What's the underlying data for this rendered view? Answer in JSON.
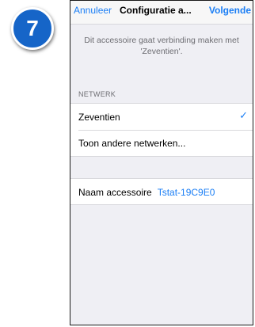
{
  "step": {
    "number": "7"
  },
  "nav": {
    "cancel_label": "Annuleer",
    "title": "Configuratie a...",
    "next_label": "Volgende"
  },
  "description": "Dit accessoire gaat verbinding maken met 'Zeventien'.",
  "network_section": {
    "header": "NETWERK",
    "items": [
      {
        "label": "Zeventien",
        "selected": true,
        "check_icon": "checkmark-icon"
      },
      {
        "label": "Toon andere netwerken...",
        "selected": false
      }
    ]
  },
  "accessory": {
    "label": "Naam accessoire",
    "value": "Tstat-19C9E0"
  },
  "colors": {
    "accent": "#1a7ef5",
    "badge": "#1665c8",
    "background": "#efeff4"
  }
}
